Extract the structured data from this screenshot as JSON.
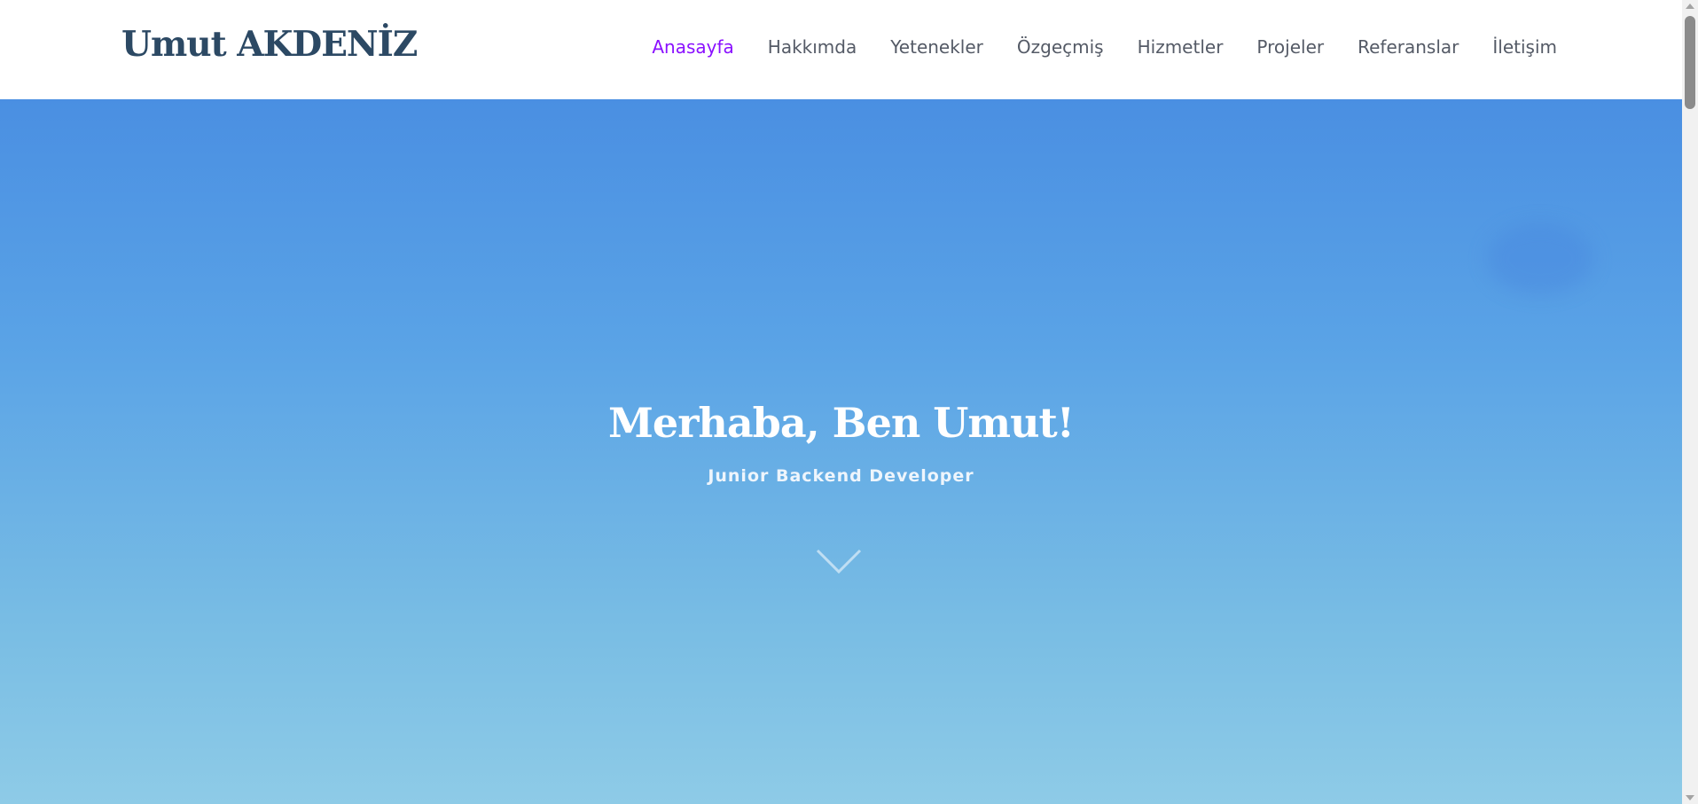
{
  "header": {
    "brand": "Umut AKDENİZ"
  },
  "nav": {
    "items": [
      {
        "label": "Anasayfa",
        "active": true
      },
      {
        "label": "Hakkımda",
        "active": false
      },
      {
        "label": "Yetenekler",
        "active": false
      },
      {
        "label": "Özgeçmiş",
        "active": false
      },
      {
        "label": "Hizmetler",
        "active": false
      },
      {
        "label": "Projeler",
        "active": false
      },
      {
        "label": "Referanslar",
        "active": false
      },
      {
        "label": "İletişim",
        "active": false
      }
    ]
  },
  "hero": {
    "title": "Merhaba, Ben Umut!",
    "subtitle": "Junior Backend Developer",
    "scroll_icon": "chevron-down-icon"
  },
  "colors": {
    "brand": "#2c4964",
    "nav_text": "#545a66",
    "nav_active": "#8a10ff",
    "hero_top": "#4a8fe2",
    "hero_bottom": "#8ecbe7"
  }
}
